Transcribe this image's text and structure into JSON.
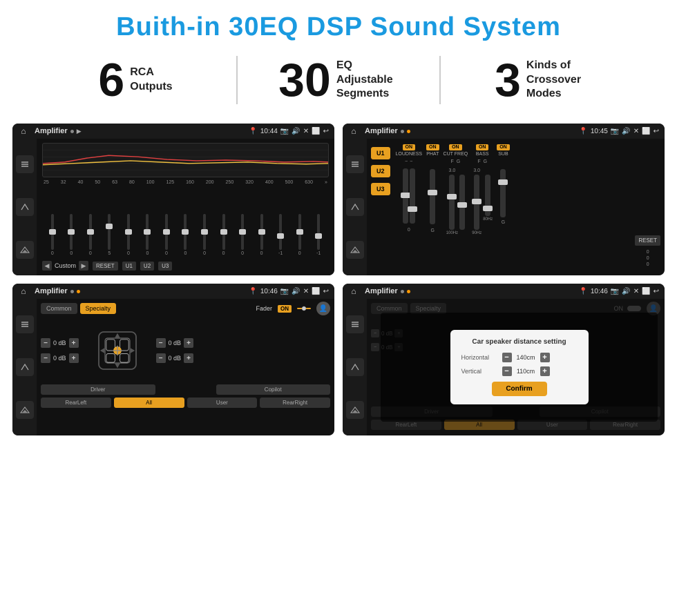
{
  "page": {
    "title": "Buith-in 30EQ DSP Sound System"
  },
  "stats": [
    {
      "number": "6",
      "label": "RCA\nOutputs"
    },
    {
      "number": "30",
      "label": "EQ Adjustable\nSegments"
    },
    {
      "number": "3",
      "label": "Kinds of\nCrossover Modes"
    }
  ],
  "screens": [
    {
      "id": "eq-screen",
      "title": "Amplifier",
      "time": "10:44",
      "type": "eq"
    },
    {
      "id": "amp-screen",
      "title": "Amplifier",
      "time": "10:45",
      "type": "amp"
    },
    {
      "id": "spk-screen",
      "title": "Amplifier",
      "time": "10:46",
      "type": "speaker"
    },
    {
      "id": "dlg-screen",
      "title": "Amplifier",
      "time": "10:46",
      "type": "dialog"
    }
  ],
  "eq": {
    "presets": [
      "Custom",
      "RESET",
      "U1",
      "U2",
      "U3"
    ],
    "freqs": [
      "25",
      "32",
      "40",
      "50",
      "63",
      "80",
      "100",
      "125",
      "160",
      "200",
      "250",
      "320",
      "400",
      "500",
      "630"
    ],
    "values": [
      "0",
      "0",
      "0",
      "5",
      "0",
      "0",
      "0",
      "0",
      "0",
      "0",
      "0",
      "0",
      "-1",
      "0",
      "-1"
    ],
    "thumbPositions": [
      26,
      26,
      26,
      18,
      26,
      26,
      26,
      26,
      26,
      26,
      26,
      26,
      32,
      26,
      32
    ]
  },
  "amp": {
    "channels": [
      {
        "label": "LOUDNESS",
        "on": true,
        "thumbPos": 40
      },
      {
        "label": "PHAT",
        "on": true,
        "thumbPos": 35
      },
      {
        "label": "CUT FREQ",
        "on": true,
        "thumbPos": 30
      },
      {
        "label": "BASS",
        "on": true,
        "thumbPos": 50
      },
      {
        "label": "SUB",
        "on": true,
        "thumbPos": 20
      }
    ],
    "uButtons": [
      "U1",
      "U2",
      "U3"
    ],
    "resetLabel": "RESET"
  },
  "speaker": {
    "tabs": [
      "Common",
      "Specialty"
    ],
    "activeTab": "Specialty",
    "faderLabel": "Fader",
    "faderOn": true,
    "sections": [
      {
        "label": "Driver",
        "value": ""
      },
      {
        "label": "Copilot",
        "value": ""
      },
      {
        "label": "RearLeft",
        "value": ""
      },
      {
        "label": "All",
        "value": ""
      },
      {
        "label": "User",
        "value": ""
      },
      {
        "label": "RearRight",
        "value": ""
      }
    ],
    "dbValues": [
      "0 dB",
      "0 dB",
      "0 dB",
      "0 dB"
    ]
  },
  "dialog": {
    "title": "Car speaker distance setting",
    "fields": [
      {
        "label": "Horizontal",
        "value": "140cm"
      },
      {
        "label": "Vertical",
        "value": "110cm"
      }
    ],
    "confirmLabel": "Confirm",
    "dbValues": [
      "0 dB",
      "0 dB"
    ],
    "bottomButtons": [
      "Driver",
      "Copilot",
      "RearLeft",
      "All",
      "User",
      "RearRight"
    ]
  }
}
